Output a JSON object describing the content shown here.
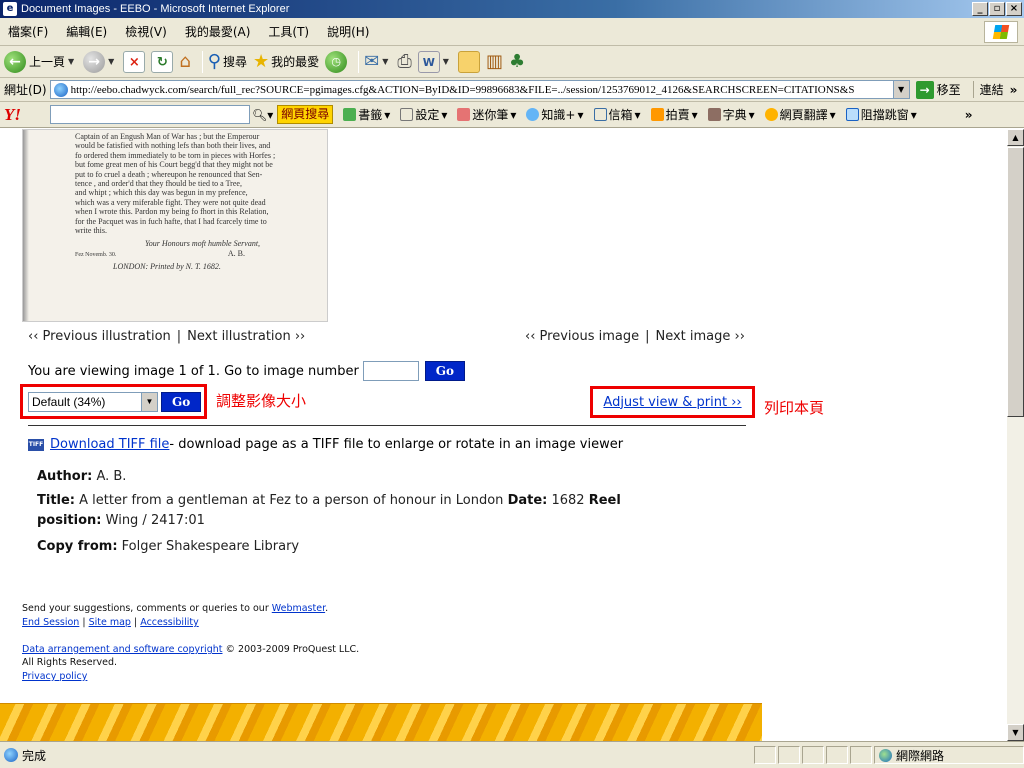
{
  "window": {
    "title": "Document Images - EEBO - Microsoft Internet Explorer"
  },
  "menu": [
    "檔案(F)",
    "編輯(E)",
    "檢視(V)",
    "我的最愛(A)",
    "工具(T)",
    "說明(H)"
  ],
  "toolbar": {
    "back_label": "上一頁",
    "search_label": "搜尋",
    "favorites_label": "我的最愛"
  },
  "address": {
    "label": "網址(D)",
    "url": "http://eebo.chadwyck.com/search/full_rec?SOURCE=pgimages.cfg&ACTION=ByID&ID=99896683&FILE=../session/1253769012_4126&SEARCHSCREEN=CITATIONS&S",
    "go_label": "移至",
    "links_label": "連結"
  },
  "yahoo": {
    "logo": "Y!",
    "search_button": "網頁搜尋",
    "items": [
      "書籤",
      "設定",
      "迷你筆",
      "知識+",
      "信箱",
      "拍賣",
      "字典",
      "網頁翻譯",
      "阻擋跳窗"
    ]
  },
  "scan": {
    "lines": [
      "Captain of an Engush Man of War has ; but the Emperour",
      "would be fatisfied with nothing lefs than both their lives, and",
      "fo ordered them immediately to be torn in pieces with Horfes ;",
      "but fome great men of his Court begg'd that they might not be",
      "put to fo cruel a death ; whereupon he renounced that Sen-",
      "tence , and order'd that they fhould be tied to a Tree,",
      "and whipt ; which this day was begun in my prefence,",
      "which was a very miferable fight. They were not quite dead",
      "when I wrote this. Pardon my being fo fhort in this Relation,",
      "for the Pacquet was in fuch hafte, that I had fcarcely time to",
      "write this."
    ],
    "signature": "Your Honours moft humble Servant,",
    "place": "Fez Novemb. 30.",
    "initials": "A. B.",
    "imprint": "LONDON: Printed by N. T. 1682."
  },
  "nav": {
    "prev_illustration": "‹‹ Previous illustration",
    "next_illustration": "Next illustration ››",
    "prev_image": "‹‹ Previous image",
    "next_image": "Next image ››",
    "separator": "|"
  },
  "viewing": {
    "text": "You are viewing image 1 of 1.  Go to image number",
    "go": "Go"
  },
  "zoom": {
    "selected": "Default (34%)",
    "go": "Go",
    "annotation": "調整影像大小"
  },
  "print": {
    "link": "Adjust view & print ››",
    "annotation": "列印本頁"
  },
  "download": {
    "icon_label": "TIFF",
    "link": "Download TIFF file",
    "desc": " - download page as a TIFF file to enlarge or rotate in an image viewer"
  },
  "record": {
    "author_label": "Author:",
    "author": " A. B.",
    "title_label": "Title:",
    "title": " A letter from a gentleman at Fez to a person of honour in London ",
    "date_label": "Date:",
    "date": " 1682 ",
    "reel_label": "Reel position:",
    "reel": " Wing / 2417:01",
    "copy_label": "Copy from:",
    "copy": " Folger Shakespeare Library"
  },
  "footer": {
    "suggest_text": "Send your suggestions, comments or queries to our ",
    "webmaster": "Webmaster",
    "period": ".",
    "end_session": "End Session",
    "site_map": "Site map",
    "accessibility": "Accessibility",
    "copyright_link": "Data arrangement and software copyright",
    "copyright_text": " © 2003-2009 ProQuest LLC.",
    "rights": "All Rights Reserved.",
    "privacy": "Privacy policy"
  },
  "status": {
    "text": "完成",
    "zone": "網際網路"
  }
}
